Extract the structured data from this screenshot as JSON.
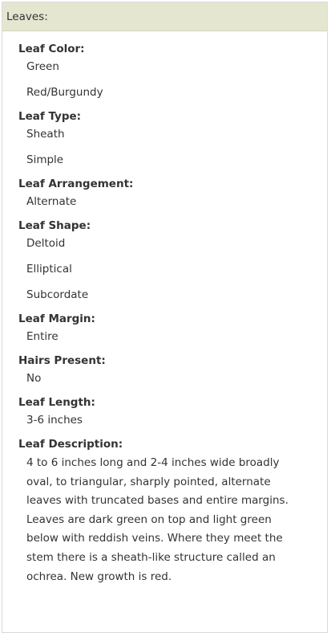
{
  "section": {
    "title": "Leaves:"
  },
  "attributes": [
    {
      "label": "Leaf Color:",
      "values": [
        "Green",
        "Red/Burgundy"
      ]
    },
    {
      "label": "Leaf Type:",
      "values": [
        "Sheath",
        "Simple"
      ]
    },
    {
      "label": "Leaf Arrangement:",
      "values": [
        "Alternate"
      ]
    },
    {
      "label": "Leaf Shape:",
      "values": [
        "Deltoid",
        "Elliptical",
        "Subcordate"
      ]
    },
    {
      "label": "Leaf Margin:",
      "values": [
        "Entire"
      ]
    },
    {
      "label": "Hairs Present:",
      "values": [
        "No"
      ]
    },
    {
      "label": "Leaf Length:",
      "values": [
        "3-6 inches"
      ]
    }
  ],
  "description": {
    "label": "Leaf Description:",
    "text": "4 to 6 inches long and 2-4 inches wide broadly oval, to triangular, sharply pointed, alternate leaves with truncated bases and entire margins. Leaves are dark green on top and light green below with reddish veins. Where they meet the stem there is a sheath-like structure called an ochrea. New growth is red."
  },
  "colors": {
    "header_background": "#e4e6d0",
    "border": "#d9d9d9",
    "text": "#333333"
  }
}
